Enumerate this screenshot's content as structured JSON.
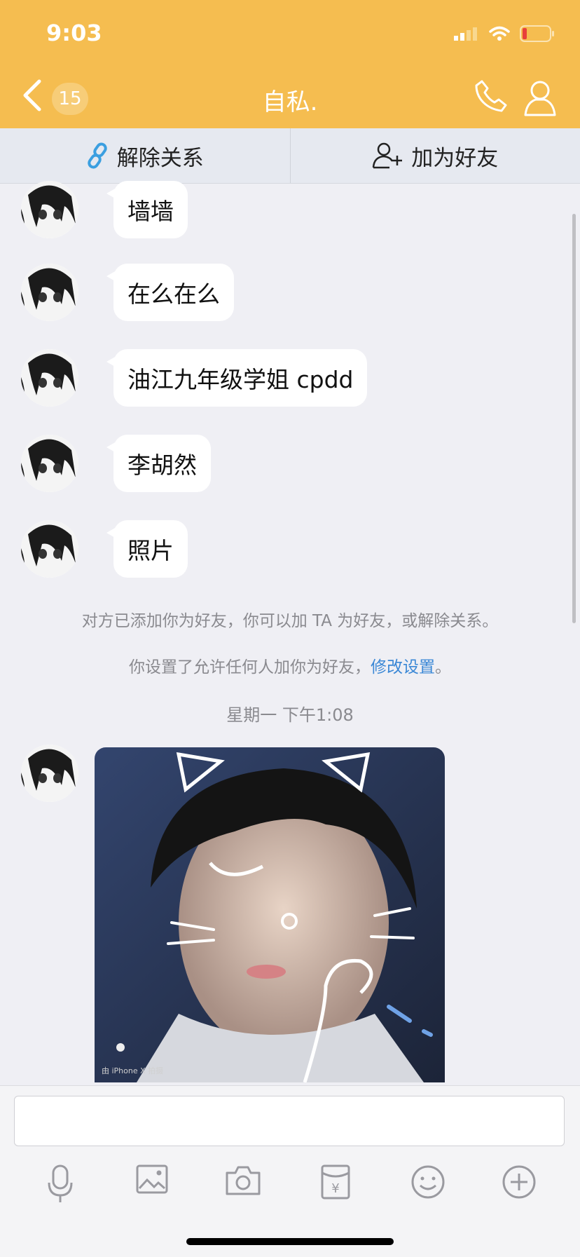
{
  "status_bar": {
    "time": "9:03"
  },
  "header": {
    "back_count": "15",
    "title": "自私."
  },
  "actions": {
    "unlink": "解除关系",
    "add_friend": "加为好友"
  },
  "messages": [
    {
      "text": "墙墙"
    },
    {
      "text": "在么在么"
    },
    {
      "text": "油江九年级学姐 cpdd"
    },
    {
      "text": "李胡然"
    },
    {
      "text": "照片"
    }
  ],
  "system": {
    "added_notice": "对方已添加你为好友，你可以加 TA 为好友，或解除关系。",
    "settings_prefix": "你设置了允许任何人加你为好友，",
    "settings_link": "修改设置",
    "settings_suffix": "。",
    "timestamp": "星期一 下午1:08"
  },
  "photo": {
    "watermark": "由 iPhone X 拍摄"
  },
  "input": {
    "placeholder": ""
  },
  "toolbar": [
    "microphone-icon",
    "image-icon",
    "camera-icon",
    "red-packet-icon",
    "emoji-icon",
    "plus-icon"
  ],
  "colors": {
    "header": "#f5bd50",
    "link": "#3b88d6",
    "background": "#efeff4"
  }
}
